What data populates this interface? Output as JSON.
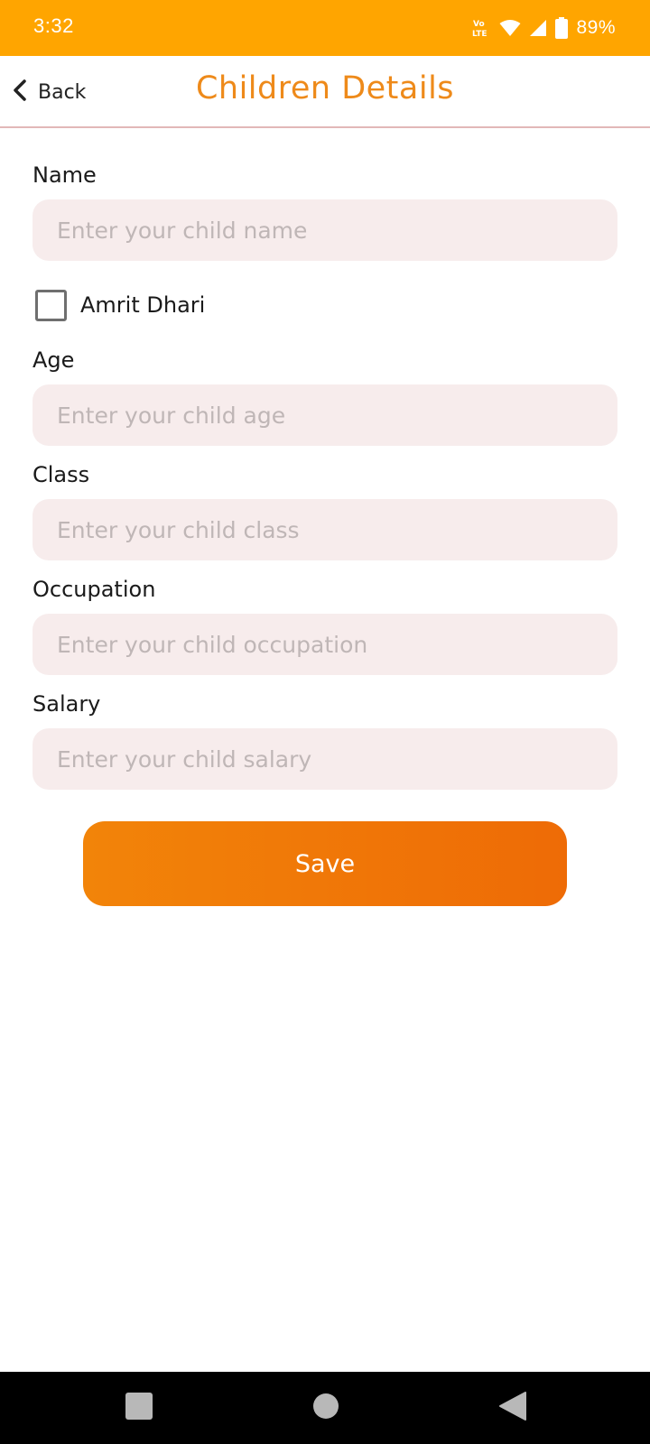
{
  "status_bar": {
    "time": "3:32",
    "battery_percent": "89%",
    "icons": [
      "volte-icon",
      "wifi-icon",
      "cell-signal-icon",
      "battery-icon"
    ]
  },
  "app_bar": {
    "back_label": "Back",
    "title": "Children Details"
  },
  "form": {
    "name": {
      "label": "Name",
      "placeholder": "Enter your child name",
      "value": ""
    },
    "amrit_dhari": {
      "label": "Amrit Dhari",
      "checked": false
    },
    "age": {
      "label": "Age",
      "placeholder": "Enter your child age",
      "value": ""
    },
    "class": {
      "label": "Class",
      "placeholder": "Enter your child class",
      "value": ""
    },
    "occupation": {
      "label": "Occupation",
      "placeholder": "Enter your child occupation",
      "value": ""
    },
    "salary": {
      "label": "Salary",
      "placeholder": "Enter your child salary",
      "value": ""
    },
    "save_label": "Save"
  },
  "colors": {
    "status_bar": "#FFA500",
    "title": "#EE8A1A",
    "input_bg": "#F7ECEC",
    "button_start": "#F28409",
    "button_end": "#EE6B06"
  },
  "nav_bar": {
    "icons": [
      "recents-icon",
      "home-icon",
      "back-icon"
    ]
  }
}
